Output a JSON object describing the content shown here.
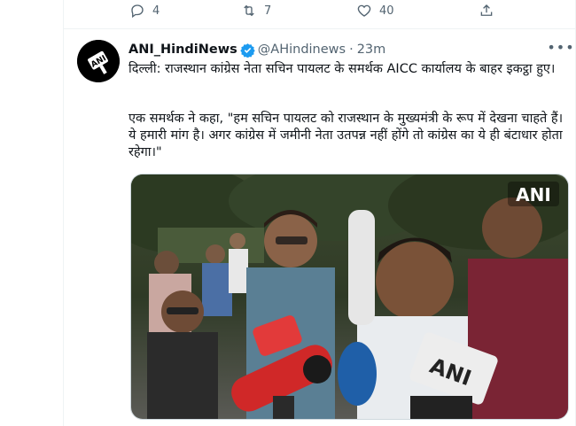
{
  "previous_tweet": {
    "reply_count": "4",
    "retweet_count": "7",
    "like_count": "40"
  },
  "tweet": {
    "display_name": "ANI_HindiNews",
    "handle": "@AHindinews",
    "separator": "·",
    "time": "23m",
    "more_icon": "•••",
    "avatar_logo": "ANI",
    "text_line1": "दिल्ली: राजस्थान कांग्रेस नेता सचिन पायलट के समर्थक AICC कार्यालय के बाहर इकट्ठा हुए।",
    "text_line2": "एक समर्थक ने कहा, \"हम सचिन पायलट को राजस्थान के मुख्यमंत्री के रूप में देखना चाहते हैं। ये हमारी मांग है। अगर कांग्रेस में जमीनी नेता उतपन्न नहीं होंगे तो कांग्रेस का ये ही बंटाधार होता रहेगा।\"",
    "media_watermark": "ANI",
    "mic_logo": "ANI"
  },
  "colors": {
    "accent": "#1d9bf0",
    "muted": "#536471",
    "border": "#eff3f4"
  }
}
